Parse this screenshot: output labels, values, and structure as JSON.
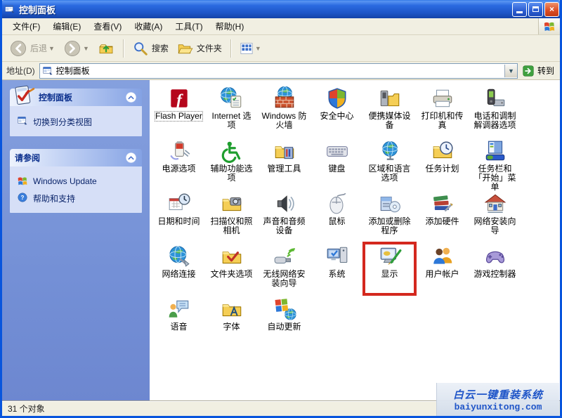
{
  "window": {
    "title": "控制面板",
    "title_icon": "control-panel-window-icon"
  },
  "menu_bar": {
    "items": [
      "文件(F)",
      "编辑(E)",
      "查看(V)",
      "收藏(A)",
      "工具(T)",
      "帮助(H)"
    ]
  },
  "toolbar": {
    "back_label": "后退",
    "search_label": "搜索",
    "folders_label": "文件夹"
  },
  "address_bar": {
    "label": "地址(D)",
    "value": "控制面板",
    "go_label": "转到"
  },
  "sidebar": {
    "panels": [
      {
        "title": "控制面板",
        "header_icon": "control-panel-icon",
        "items": [
          {
            "label": "切换到分类视图",
            "icon": "switch-view-icon"
          }
        ]
      },
      {
        "title": "请参阅",
        "items": [
          {
            "label": "Windows Update",
            "icon": "windows-update-icon"
          },
          {
            "label": "帮助和支持",
            "icon": "help-icon"
          }
        ]
      }
    ]
  },
  "content": {
    "items": [
      {
        "label": "Flash Player",
        "icon": "flash-player-icon",
        "selected": true
      },
      {
        "label": "Internet 选项",
        "icon": "internet-options-icon"
      },
      {
        "label": "Windows 防火墙",
        "icon": "firewall-icon"
      },
      {
        "label": "安全中心",
        "icon": "security-center-icon"
      },
      {
        "label": "便携媒体设备",
        "icon": "portable-media-icon"
      },
      {
        "label": "打印机和传真",
        "icon": "printers-icon"
      },
      {
        "label": "电话和调制解调器选项",
        "icon": "phone-modem-icon"
      },
      {
        "label": "电源选项",
        "icon": "power-options-icon"
      },
      {
        "label": "辅助功能选项",
        "icon": "accessibility-icon"
      },
      {
        "label": "管理工具",
        "icon": "admin-tools-icon"
      },
      {
        "label": "键盘",
        "icon": "keyboard-icon"
      },
      {
        "label": "区域和语言选项",
        "icon": "regional-language-icon"
      },
      {
        "label": "任务计划",
        "icon": "scheduled-tasks-icon"
      },
      {
        "label": "任务栏和「开始」菜单",
        "icon": "taskbar-startmenu-icon"
      },
      {
        "label": "日期和时间",
        "icon": "date-time-icon"
      },
      {
        "label": "扫描仪和照相机",
        "icon": "scanners-cameras-icon"
      },
      {
        "label": "声音和音频设备",
        "icon": "sounds-audio-icon"
      },
      {
        "label": "鼠标",
        "icon": "mouse-icon"
      },
      {
        "label": "添加或删除程序",
        "icon": "add-remove-programs-icon"
      },
      {
        "label": "添加硬件",
        "icon": "add-hardware-icon"
      },
      {
        "label": "网络安装向导",
        "icon": "network-setup-wizard-icon"
      },
      {
        "label": "网络连接",
        "icon": "network-connections-icon"
      },
      {
        "label": "文件夹选项",
        "icon": "folder-options-icon"
      },
      {
        "label": "无线网络安装向导",
        "icon": "wireless-network-wizard-icon"
      },
      {
        "label": "系统",
        "icon": "system-icon"
      },
      {
        "label": "显示",
        "icon": "display-icon",
        "highlighted": true
      },
      {
        "label": "用户帐户",
        "icon": "user-accounts-icon"
      },
      {
        "label": "游戏控制器",
        "icon": "game-controllers-icon"
      },
      {
        "label": "语音",
        "icon": "speech-icon"
      },
      {
        "label": "字体",
        "icon": "fonts-icon"
      },
      {
        "label": "自动更新",
        "icon": "automatic-updates-icon"
      }
    ]
  },
  "status_bar": {
    "text": "31 个对象"
  },
  "watermark": {
    "line1": "白云一键重装系统",
    "line2": "baiyunxitong.com"
  },
  "colors": {
    "titlebar_blue": "#1E56C8",
    "window_border": "#0855DD",
    "taskpane_blue": "#7490D6",
    "panel_body": "#D6DFF7",
    "chrome_tan": "#F1EFE2",
    "highlight_red": "#D4281E",
    "watermark_blue": "#1F55C8"
  }
}
